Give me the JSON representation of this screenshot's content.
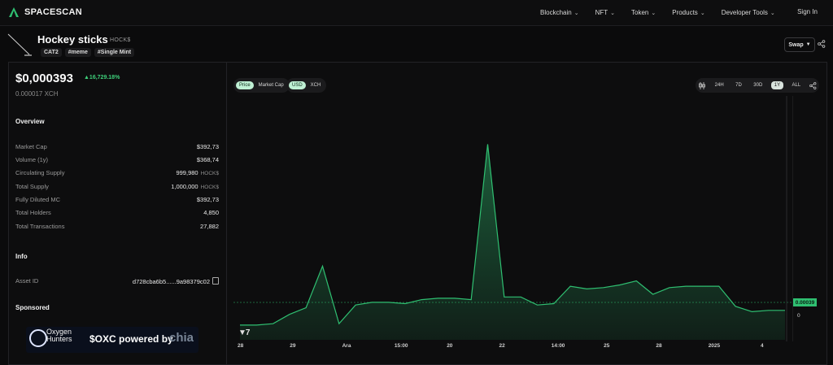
{
  "brand": {
    "name": "SPACESCAN"
  },
  "nav": {
    "items": [
      {
        "label": "Blockchain"
      },
      {
        "label": "NFT"
      },
      {
        "label": "Token"
      },
      {
        "label": "Products"
      },
      {
        "label": "Developer Tools"
      }
    ],
    "sign_in": "Sign In"
  },
  "token": {
    "name": "Hockey sticks",
    "symbol": "HOCK$",
    "tags": [
      "CAT2",
      "#meme",
      "#Single Mint"
    ],
    "swap_label": "Swap"
  },
  "price": {
    "value": "$0,000393",
    "change": "▲16,729.18%",
    "xch": "0.000017 XCH"
  },
  "overview": {
    "title": "Overview",
    "rows": [
      {
        "label": "Market Cap",
        "value": "$392,73",
        "unit": ""
      },
      {
        "label": "Volume (1y)",
        "value": "$368,74",
        "unit": ""
      },
      {
        "label": "Circulating Supply",
        "value": "999,980",
        "unit": "HOCK$"
      },
      {
        "label": "Total Supply",
        "value": "1,000,000",
        "unit": "HOCK$"
      },
      {
        "label": "Fully Diluted MC",
        "value": "$392,73",
        "unit": ""
      },
      {
        "label": "Total Holders",
        "value": "4,850",
        "unit": ""
      },
      {
        "label": "Total Transactions",
        "value": "27,882",
        "unit": ""
      }
    ]
  },
  "info": {
    "title": "Info",
    "asset_id_label": "Asset ID",
    "asset_id_value": "d728cba6b5......9a98379c02"
  },
  "sponsored": {
    "title": "Sponsored",
    "name_line1": "Oxygen",
    "name_line2": "Hunters",
    "headline": "$OXC powered by",
    "brand": "chia"
  },
  "chart_controls": {
    "mode_options": [
      "Price",
      "Market Cap"
    ],
    "mode_selected": "Price",
    "currency_options": [
      "USD",
      "XCH"
    ],
    "currency_selected": "USD",
    "ranges": [
      "24H",
      "7D",
      "30D",
      "1Y",
      "ALL"
    ],
    "range_selected": "1Y"
  },
  "chart_data": {
    "type": "area",
    "x_tick_labels": [
      "28",
      "29",
      "Ara",
      "15:00",
      "20",
      "22",
      "14:00",
      "25",
      "28",
      "2025",
      "4"
    ],
    "y_axis_labels": [
      "0.00039",
      "0"
    ],
    "current_price_label": "0.00039",
    "series": [
      {
        "color": "#2fbf71",
        "values": [
          0.00011,
          0.00011,
          0.00012,
          0.00019,
          0.00024,
          0.00055,
          0.00012,
          0.00026,
          0.00028,
          0.00028,
          0.00027,
          0.0003,
          0.00031,
          0.00031,
          0.0003,
          0.00146,
          0.00032,
          0.00032,
          0.00026,
          0.00027,
          0.0004,
          0.00038,
          0.00039,
          0.00041,
          0.00044,
          0.00034,
          0.00039,
          0.0004,
          0.0004,
          0.0004,
          0.00025,
          0.00021,
          0.00022,
          0.00022
        ]
      }
    ],
    "ylim": [
      0,
      0.0017
    ]
  }
}
